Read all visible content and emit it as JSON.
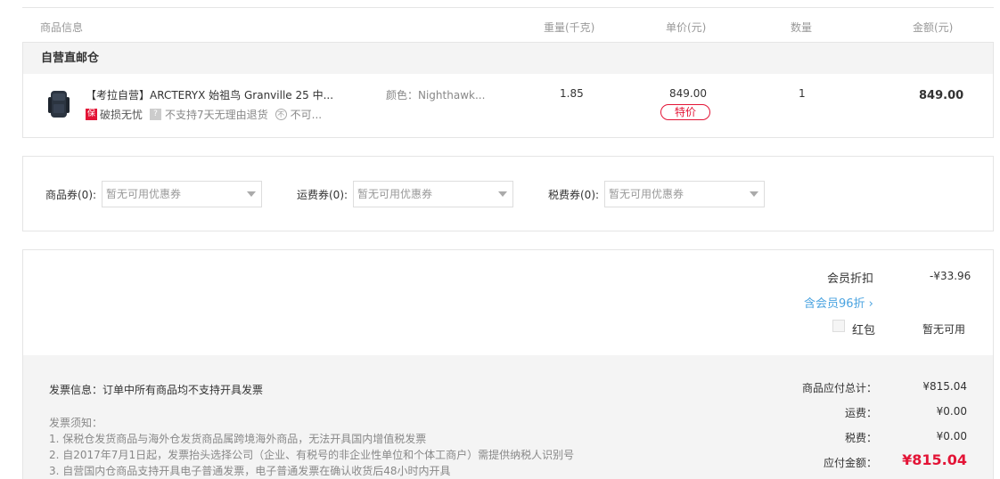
{
  "table_header": {
    "info": "商品信息",
    "weight": "重量(千克)",
    "unit_price": "单价(元)",
    "quantity": "数量",
    "amount": "金额(元)"
  },
  "warehouse": "自营直邮仓",
  "product": {
    "name": "【考拉自营】ARCTERYX 始祖鸟 Granville 25 中...",
    "tag_bao": "保",
    "tag1": "破损无忧",
    "tag_q": "?",
    "tag2": "不支持7天无理由退货",
    "tag_ban": "不",
    "tag3": "不可...",
    "color": "颜色：Nighthawk...",
    "weight": "1.85",
    "price": "849.00",
    "price_badge": "特价",
    "quantity": "1",
    "amount": "849.00"
  },
  "coupons": {
    "goods_label": "商品券(0):",
    "goods_value": "暂无可用优惠券",
    "shipping_label": "运费券(0):",
    "shipping_value": "暂无可用优惠券",
    "tax_label": "税费券(0):",
    "tax_value": "暂无可用优惠券"
  },
  "summary": {
    "member_discount_label": "会员折扣",
    "member_discount_value": "-¥33.96",
    "vip_link": "含会员96折 ›",
    "redpacket_label": "红包",
    "redpacket_value": "暂无可用"
  },
  "invoice": {
    "title": "发票信息：订单中所有商品均不支持开具发票",
    "notes_title": "发票须知：",
    "note1": "1. 保税仓发货商品与海外仓发货商品属跨境海外商品，无法开具国内增值税发票",
    "note2": "2. 自2017年7月1日起，发票抬头选择公司（企业、有税号的非企业性单位和个体工商户）需提供纳税人识别号",
    "note3": "3. 自营国内仓商品支持开具电子普通发票，电子普通发票在确认收货后48小时内开具"
  },
  "totals": {
    "goods_total_label": "商品应付总计：",
    "goods_total_value": "¥815.04",
    "shipping_label": "运费：",
    "shipping_value": "¥0.00",
    "tax_label": "税费：",
    "tax_value": "¥0.00",
    "payable_label": "应付金额：",
    "payable_value": "¥815.04"
  },
  "colors": {
    "accent": "#e31436",
    "link": "#4aa3e0"
  }
}
